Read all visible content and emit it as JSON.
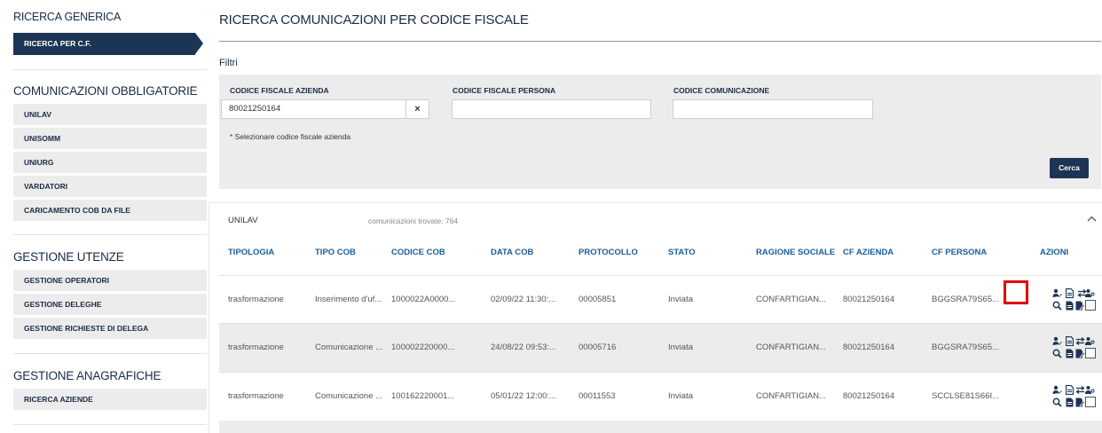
{
  "sidebar": {
    "ricerca_generica": "RICERCA GENERICA",
    "ricerca_per_cf": "RICERCA PER C.F.",
    "comunicazioni_title": "COMUNICAZIONI OBBLIGATORIE",
    "comunicazioni_items": [
      "UNILAV",
      "UNISOMM",
      "UNIURG",
      "VARDATORI",
      "CARICAMENTO COB DA FILE"
    ],
    "gestione_utenze_title": "GESTIONE UTENZE",
    "gestione_utenze_items": [
      "GESTIONE OPERATORI",
      "GESTIONE DELEGHE",
      "GESTIONE RICHIESTE DI DELEGA"
    ],
    "gestione_anagrafiche_title": "GESTIONE ANAGRAFICHE",
    "gestione_anagrafiche_items": [
      "RICERCA AZIENDE"
    ]
  },
  "main": {
    "title": "RICERCA COMUNICAZIONI PER CODICE FISCALE",
    "filtri": "Filtri",
    "filters": {
      "cf_azienda_label": "CODICE FISCALE AZIENDA",
      "cf_azienda_value": "80021250164",
      "cf_persona_label": "CODICE FISCALE PERSONA",
      "cf_persona_value": "",
      "codice_com_label": "CODICE COMUNICAZIONE",
      "codice_com_value": "",
      "clear_symbol": "×",
      "hint": "* Selezionare codice fiscale azienda",
      "cerca": "Cerca"
    },
    "results": {
      "section": "UNILAV",
      "count": "comunicazioni trovate: 764",
      "columns": [
        "TIPOLOGIA",
        "TIPO COB",
        "CODICE COB",
        "DATA COB",
        "PROTOCOLLO",
        "STATO",
        "RAGIONE SOCIALE",
        "CF AZIENDA",
        "CF PERSONA",
        "AZIONI"
      ],
      "rows": [
        [
          "trasformazione",
          "Inserimento d'uf...",
          "1000022A0000...",
          "02/09/22 11:30:...",
          "00005851",
          "Inviata",
          "CONFARTIGIAN...",
          "80021250164",
          "BGGSRA79S65..."
        ],
        [
          "trasformazione",
          "Comunicazione ...",
          "100002220000...",
          "24/08/22 09:53:...",
          "00005716",
          "Inviata",
          "CONFARTIGIAN...",
          "80021250164",
          "BGGSRA79S65..."
        ],
        [
          "trasformazione",
          "Comunicazione ...",
          "100162220001...",
          "05/01/22 12:00:...",
          "00011553",
          "Inviata",
          "CONFARTIGIAN...",
          "80021250164",
          "SCCLSE81S66I..."
        ]
      ]
    }
  },
  "icons": {
    "user_edit": "👤",
    "document": "🗎",
    "transfer": "⇄",
    "users": "👥",
    "search": "🔍",
    "file": "🗎",
    "file_edit": "✎",
    "chevron_up": "^"
  },
  "colors": {
    "navy": "#1d3554",
    "header_blue": "#1a5d9a",
    "panel_gray": "#ececec",
    "highlight_red": "#e00000"
  }
}
